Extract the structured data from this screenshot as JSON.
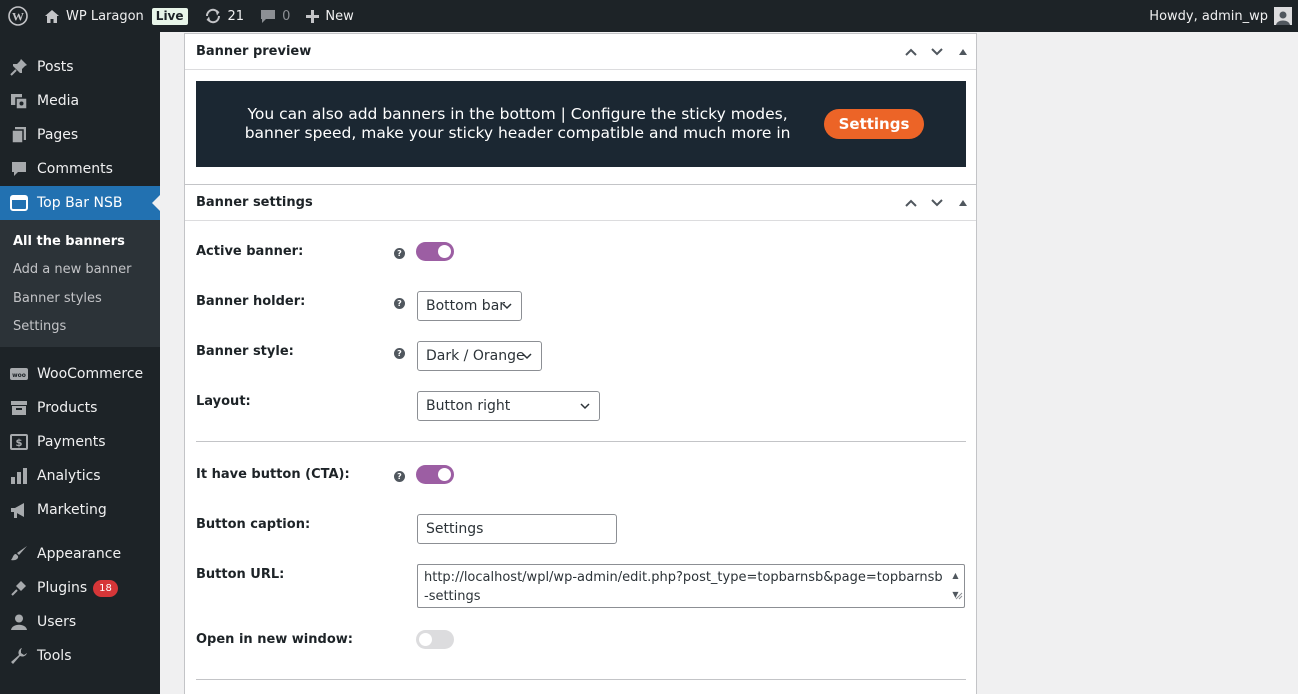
{
  "adminbar": {
    "site_name": "WP Laragon",
    "live_badge": "Live",
    "updates_count": "21",
    "comments_count": "0",
    "new_label": "New",
    "greeting": "Howdy, admin_wp"
  },
  "sidebar": {
    "items_top": [
      {
        "label": "Posts",
        "icon": "pin-icon"
      },
      {
        "label": "Media",
        "icon": "media-icon"
      },
      {
        "label": "Pages",
        "icon": "pages-icon"
      },
      {
        "label": "Comments",
        "icon": "comment-icon"
      },
      {
        "label": "Top Bar NSB",
        "icon": "window-icon"
      }
    ],
    "submenu": [
      "All the banners",
      "Add a new banner",
      "Banner styles",
      "Settings"
    ],
    "items_bottom": [
      {
        "label": "WooCommerce",
        "icon": "woo-icon"
      },
      {
        "label": "Products",
        "icon": "archive-icon"
      },
      {
        "label": "Payments",
        "icon": "dollar-icon"
      },
      {
        "label": "Analytics",
        "icon": "chart-icon"
      },
      {
        "label": "Marketing",
        "icon": "megaphone-icon"
      },
      {
        "label": "Appearance",
        "icon": "brush-icon"
      },
      {
        "label": "Plugins",
        "icon": "plug-icon",
        "badge": "18"
      },
      {
        "label": "Users",
        "icon": "user-icon"
      },
      {
        "label": "Tools",
        "icon": "wrench-icon"
      }
    ]
  },
  "preview_box": {
    "title": "Banner preview",
    "banner_text": "You can also add banners in the bottom | Configure the sticky modes, banner speed, make your sticky header compatible and much more in",
    "banner_button": "Settings",
    "banner_bg": "#1b2732",
    "button_color": "#ec6427"
  },
  "settings_box": {
    "title": "Banner settings",
    "active_label": "Active banner:",
    "active_on": true,
    "holder_label": "Banner holder:",
    "holder_value": "Bottom bar",
    "style_label": "Banner style:",
    "style_value": "Dark / Orange",
    "layout_label": "Layout:",
    "layout_value": "Button right",
    "cta_label": "It have button (CTA):",
    "cta_on": true,
    "caption_label": "Button caption:",
    "caption_value": "Settings",
    "url_label": "Button URL:",
    "url_value": "http://localhost/wpl/wp-admin/edit.php?post_type=topbarnsb&page=topbarnsb-settings",
    "newwin_label": "Open in new window:",
    "newwin_on": false
  },
  "colors": {
    "accent": "#2271b1",
    "toggle_on": "#9c5ea3"
  }
}
